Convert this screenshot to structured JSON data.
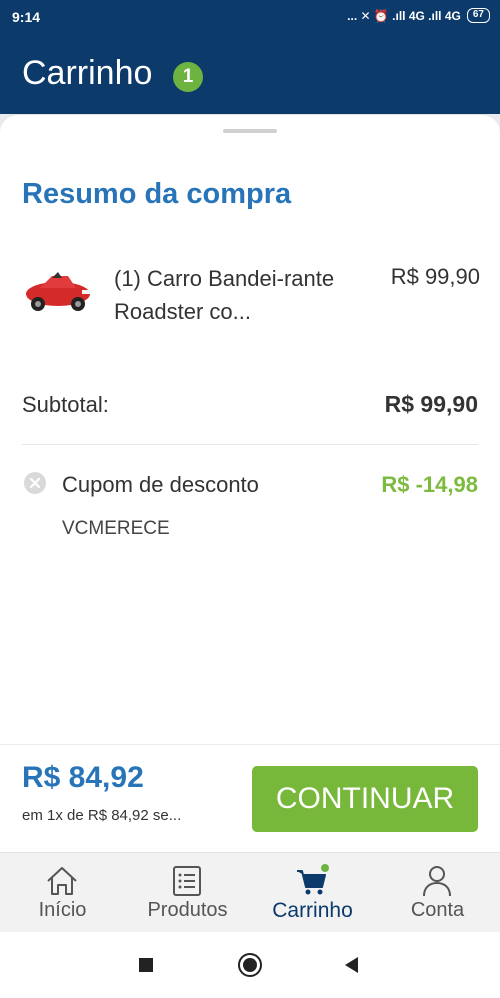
{
  "status_bar": {
    "time": "9:14",
    "indicators": "... ✕ ⏰ .ıll 4G .ıll 4G",
    "battery": "67"
  },
  "header": {
    "title": "Carrinho",
    "badge_count": "1"
  },
  "summary": {
    "title": "Resumo da compra",
    "item": {
      "name": "(1) Carro Bandei-rante Roadster co...",
      "price": "R$ 99,90"
    },
    "subtotal_label": "Subtotal:",
    "subtotal_value": "R$ 99,90",
    "coupon_label": "Cupom de desconto",
    "coupon_value": "R$ -14,98",
    "coupon_code": "VCMERECE"
  },
  "checkout": {
    "total": "R$ 84,92",
    "installments": "em 1x de R$ 84,92 se...",
    "button_label": "CONTINUAR"
  },
  "nav": {
    "items": [
      {
        "label": "Início",
        "icon": "home-icon"
      },
      {
        "label": "Produtos",
        "icon": "list-icon"
      },
      {
        "label": "Carrinho",
        "icon": "cart-icon"
      },
      {
        "label": "Conta",
        "icon": "user-icon"
      }
    ],
    "active": "Carrinho"
  },
  "colors": {
    "header_bg": "#0b3a6b",
    "accent_blue": "#2874b9",
    "accent_green": "#77b83a",
    "discount_green": "#7dbb3f"
  }
}
